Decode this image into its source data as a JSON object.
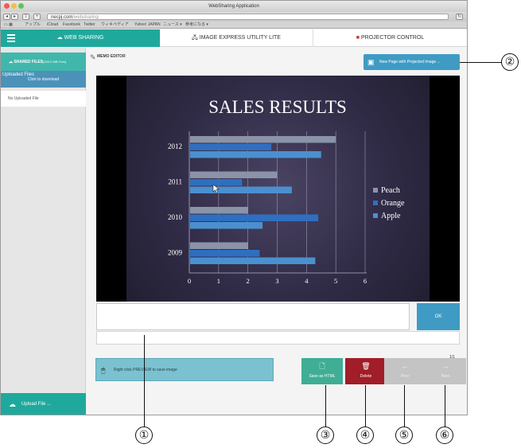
{
  "window": {
    "title": "WebSharing Application",
    "url_host": "necpj.com",
    "url_path": "/websharing",
    "bookmarks": [
      "アップル",
      "iCloud",
      "Facebook",
      "Twitter",
      "ウィキペディア",
      "Yahoo! JAPAN",
      "ニュース ▾",
      "参考になる ▾"
    ]
  },
  "nav": {
    "tabs": [
      {
        "label": "WEB SHARING",
        "active": true
      },
      {
        "label": "IMAGE EXPRESS UTILITY LITE",
        "active": false
      },
      {
        "label": "PROJECTOR CONTROL",
        "active": false
      }
    ]
  },
  "sidebar": {
    "shared_files": "SHARED FILES",
    "shared_files_size": "(200.0 MB Free)",
    "uploaded_files": "Uploaded Files",
    "click_to_download": "Click to download",
    "no_uploaded": "No Uploaded File",
    "upload_button": "Upload File ..."
  },
  "memo_editor": "MEMO EDITOR",
  "new_page_button": "New Page with Projected Image ...",
  "memo_input_value": "",
  "ok_button": "OK",
  "page_indicator": "1/1",
  "hint_text": "Right click PREVIEW to save image",
  "buttons": {
    "save": "Save as HTML",
    "delete": "Delete",
    "prev": "Prev",
    "next": "Next"
  },
  "callouts": [
    "①",
    "②",
    "③",
    "④",
    "⑤",
    "⑥"
  ],
  "chart_data": {
    "type": "bar",
    "orientation": "horizontal",
    "title": "SALES RESULTS",
    "categories": [
      "2012",
      "2011",
      "2010",
      "2009"
    ],
    "series": [
      {
        "name": "Peach",
        "color": "#8a93a8",
        "values": [
          5,
          3,
          2,
          2
        ]
      },
      {
        "name": "Orange",
        "color": "#2e6fc0",
        "values": [
          2.8,
          1.8,
          4.4,
          2.4
        ]
      },
      {
        "name": "Apple",
        "color": "#4a90d0",
        "values": [
          4.5,
          3.5,
          2.5,
          4.3
        ]
      }
    ],
    "xlim": [
      0,
      6
    ],
    "xticks": [
      "0",
      "1",
      "2",
      "3",
      "4",
      "5",
      "6"
    ],
    "legend": "right",
    "grid": true
  }
}
